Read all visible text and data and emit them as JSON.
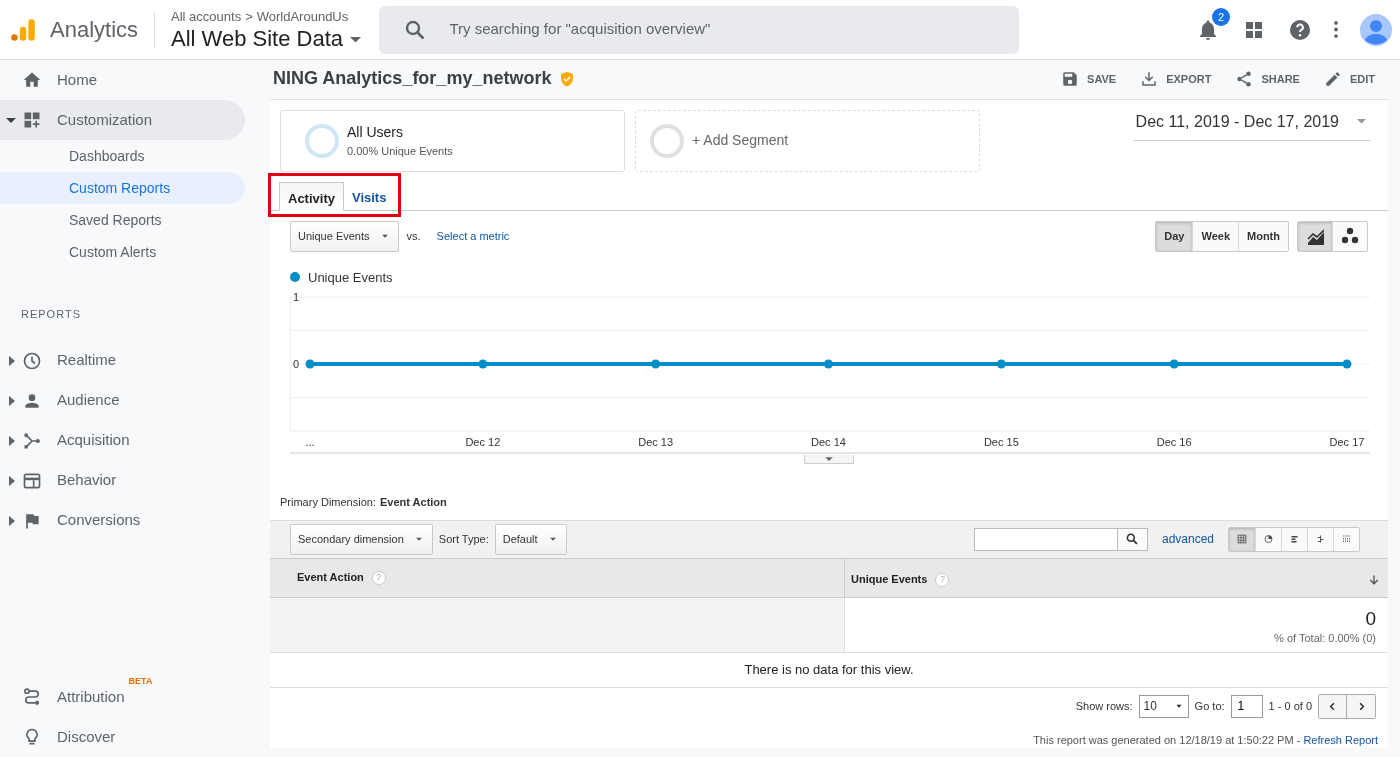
{
  "header": {
    "product": "Analytics",
    "breadcrumb": [
      "All accounts",
      "WorldAroundUs"
    ],
    "breadcrumb_separator": ">",
    "property": "All Web Site Data",
    "search": {
      "placeholder": "Try searching for \"acquisition overview\""
    },
    "notifications": "2"
  },
  "sidebar": {
    "items": [
      {
        "label": "Home",
        "active": false
      },
      {
        "label": "Customization",
        "active": true,
        "expanded": true,
        "children": [
          {
            "label": "Dashboards",
            "selected": false
          },
          {
            "label": "Custom Reports",
            "selected": true
          },
          {
            "label": "Saved Reports",
            "selected": false
          },
          {
            "label": "Custom Alerts",
            "selected": false
          }
        ]
      }
    ],
    "section": "REPORTS",
    "reports": [
      {
        "label": "Realtime",
        "expanded": false
      },
      {
        "label": "Audience",
        "expanded": false
      },
      {
        "label": "Acquisition",
        "expanded": false
      },
      {
        "label": "Behavior",
        "expanded": false
      },
      {
        "label": "Conversions",
        "expanded": false
      }
    ],
    "footer_items": [
      {
        "label": "Attribution",
        "badge": "BETA"
      },
      {
        "label": "Discover"
      }
    ]
  },
  "report": {
    "title": "NING Analytics_for_my_network",
    "verified": true,
    "actions": [
      "SAVE",
      "EXPORT",
      "SHARE",
      "EDIT"
    ],
    "segments": [
      {
        "kind": "segment",
        "name": "All Users",
        "detail": "0.00% Unique Events"
      },
      {
        "kind": "add",
        "name": "+ Add Segment"
      }
    ],
    "date_range": "Dec 11, 2019 - Dec 17, 2019",
    "tabs": [
      {
        "label": "Activity",
        "selected": true
      },
      {
        "label": "Visits",
        "selected": false
      }
    ],
    "metric": "Unique Events",
    "vs": "vs.",
    "compare_link": "Select a metric",
    "intervals": [
      {
        "label": "Day",
        "selected": true
      },
      {
        "label": "Week",
        "selected": false
      },
      {
        "label": "Month",
        "selected": false
      }
    ],
    "chart_types": [
      {
        "selected": true
      },
      {
        "selected": false
      }
    ],
    "chart_data": {
      "type": "line",
      "categories": [
        "...",
        "Dec 12",
        "Dec 13",
        "Dec 14",
        "Dec 15",
        "Dec 16",
        "Dec 17"
      ],
      "series": [
        {
          "name": "Unique Events",
          "color": "#058dc7",
          "marker": "circle",
          "values": [
            0,
            0,
            0,
            0,
            0,
            0,
            0
          ]
        }
      ],
      "ylim": [
        -1,
        1
      ],
      "yticks": [
        0,
        1
      ]
    },
    "primary_dimension_label": "Primary Dimension:",
    "primary_dimension": "Event Action",
    "secondary_dimension": "Secondary dimension",
    "sort_type_label": "Sort Type:",
    "sort_type": "Default",
    "advanced": "advanced",
    "views": [
      {
        "selected": true
      },
      {
        "selected": false
      },
      {
        "selected": false
      },
      {
        "selected": false
      },
      {
        "selected": false
      }
    ],
    "table": {
      "columns": [
        {
          "label": "Event Action",
          "hint": "?",
          "sorted": false
        },
        {
          "label": "Unique Events",
          "hint": "?",
          "sorted": true
        }
      ],
      "totals": {
        "value": "0",
        "share": "% of Total: 0.00% (0)"
      },
      "empty_message": "There is no data for this view."
    },
    "pagination": {
      "show_rows_label": "Show rows:",
      "rows": "10",
      "goto_label": "Go to:",
      "page": "1",
      "range": "1 - 0 of 0"
    },
    "generated": "This report was generated on 12/18/19 at 1:50:22 PM - ",
    "refresh_link": "Refresh Report"
  }
}
